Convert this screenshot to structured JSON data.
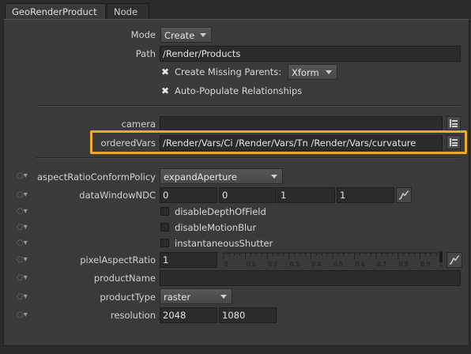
{
  "tabs": [
    {
      "label": "GeoRenderProduct"
    },
    {
      "label": "Node"
    }
  ],
  "mode": {
    "label": "Mode",
    "value": "Create"
  },
  "path": {
    "label": "Path",
    "value": "/Render/Products"
  },
  "create_missing_parents": {
    "label": "Create Missing Parents:",
    "checked": true,
    "type_value": "Xform"
  },
  "auto_populate": {
    "label": "Auto-Populate Relationships",
    "checked": true
  },
  "camera": {
    "label": "camera",
    "value": ""
  },
  "ordered_vars": {
    "label": "orderedVars",
    "value": "/Render/Vars/Ci /Render/Vars/Tn /Render/Vars/curvature"
  },
  "aspect_ratio_conform_policy": {
    "label": "aspectRatioConformPolicy",
    "value": "expandAperture"
  },
  "data_window_ndc": {
    "label": "dataWindowNDC",
    "values": [
      "0",
      "0",
      "1",
      "1"
    ]
  },
  "disable_depth_of_field": {
    "label": "disableDepthOfField",
    "checked": false
  },
  "disable_motion_blur": {
    "label": "disableMotionBlur",
    "checked": false
  },
  "instantaneous_shutter": {
    "label": "instantaneousShutter",
    "checked": false
  },
  "pixel_aspect_ratio": {
    "label": "pixelAspectRatio",
    "value": "1",
    "slider_ticks": [
      "0",
      "0.1",
      "0.2",
      "0.3",
      "0.4",
      "0.5",
      "0.6",
      "0.7",
      "0.8",
      "0.9",
      "1"
    ]
  },
  "product_name": {
    "label": "productName",
    "value": ""
  },
  "product_type": {
    "label": "productType",
    "value": "raster"
  },
  "resolution": {
    "label": "resolution",
    "values": [
      "2048",
      "1080"
    ]
  },
  "colors": {
    "highlight": "#f2a62c",
    "panel": "#3a3a3a",
    "field": "#2b2b2b"
  }
}
